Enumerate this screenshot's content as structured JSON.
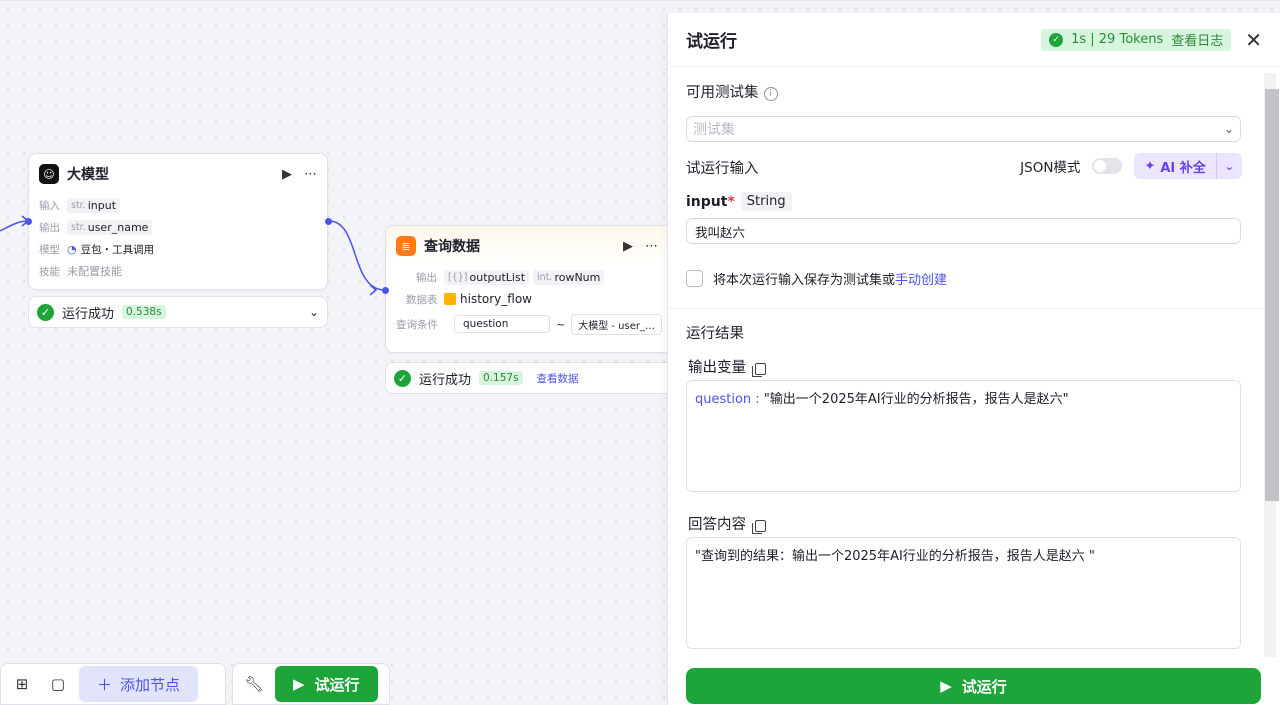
{
  "nodes": {
    "llm": {
      "title": "大模型",
      "input_label": "输入",
      "input_type": "str.",
      "input_var": "input",
      "output_label": "输出",
      "output_type": "str.",
      "output_var": "user_name",
      "model_label": "模型",
      "model_value": "豆包・工具调用",
      "skill_label": "技能",
      "skill_value": "未配置技能",
      "status": "运行成功",
      "duration": "0.538s"
    },
    "query": {
      "title": "查询数据",
      "output_label": "输出",
      "output_type_1": "[{}]",
      "output_var_1": "outputList",
      "output_type_2": "int.",
      "output_var_2": "rowNum",
      "table_label": "数据表",
      "table_value": "history_flow",
      "cond_label": "查询条件",
      "cond_field": "question",
      "cond_op": "~",
      "cond_value": "大模型 - user_…",
      "status": "运行成功",
      "duration": "0.157s",
      "view_data": "查看数据"
    }
  },
  "toolbar": {
    "add_node": "添加节点",
    "run": "试运行"
  },
  "panel": {
    "title": "试运行",
    "token_badge": "1s | 29 Tokens",
    "view_log": "查看日志",
    "testset_label": "可用测试集",
    "testset_placeholder": "测试集",
    "run_input_label": "试运行输入",
    "json_mode": "JSON模式",
    "ai_fill": "AI 补全",
    "input_name": "input",
    "input_required": "*",
    "input_type": "String",
    "input_value": "我叫赵六",
    "save_text": "将本次运行输入保存为测试集或",
    "manual_create": "手动创建",
    "result_label": "运行结果",
    "output_var_label": "输出变量",
    "output_key": "question :",
    "output_value": "\"输出一个2025年AI行业的分析报告，报告人是赵六\"",
    "answer_label": "回答内容",
    "answer_value": "\"查询到的结果：输出一个2025年AI行业的分析报告，报告人是赵六 \"",
    "run_button": "试运行"
  },
  "colors": {
    "accent": "#4d53e8",
    "success": "#1ea539",
    "ai": "#6b3ef0"
  }
}
